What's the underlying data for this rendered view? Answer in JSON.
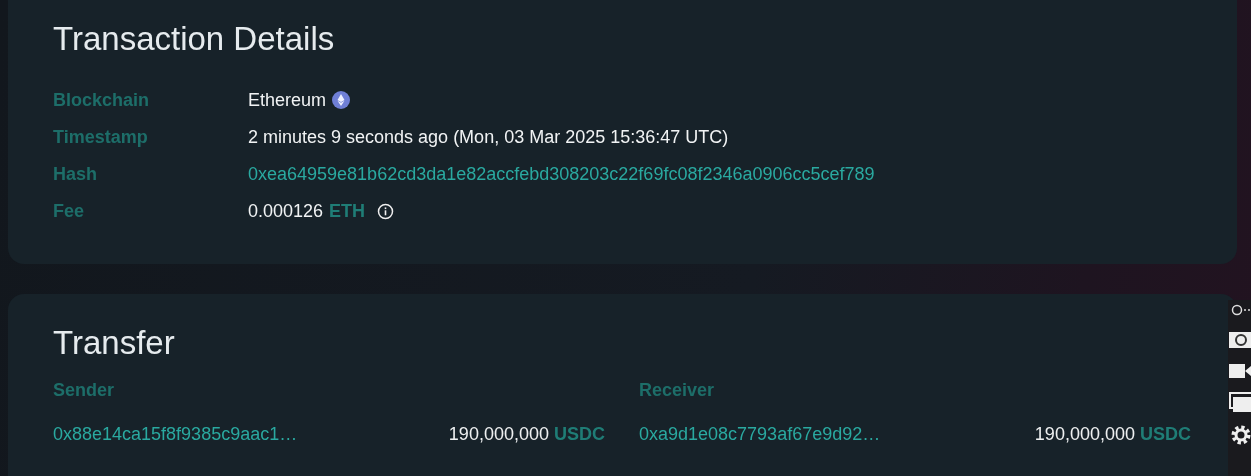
{
  "transaction_details": {
    "title": "Transaction Details",
    "rows": [
      {
        "kind": "chain",
        "label": "Blockchain",
        "value": "Ethereum"
      },
      {
        "kind": "text",
        "label": "Timestamp",
        "value": "2 minutes 9 seconds ago (Mon, 03 Mar 2025 15:36:47 UTC)"
      },
      {
        "kind": "link",
        "label": "Hash",
        "value": "0xea64959e81b62cd3da1e82accfebd308203c22f69fc08f2346a0906cc5cef789"
      },
      {
        "kind": "fee",
        "label": "Fee",
        "value": "0.000126",
        "unit": "ETH"
      }
    ]
  },
  "transfer": {
    "title": "Transfer",
    "sender_heading": "Sender",
    "receiver_heading": "Receiver",
    "sender": {
      "address": "0x88e14ca15f8f9385c9aac1…",
      "amount": "190,000,000",
      "token": "USDC"
    },
    "receiver": {
      "address": "0xa9d1e08c7793af67e9d92…",
      "amount": "190,000,000",
      "token": "USDC"
    }
  }
}
